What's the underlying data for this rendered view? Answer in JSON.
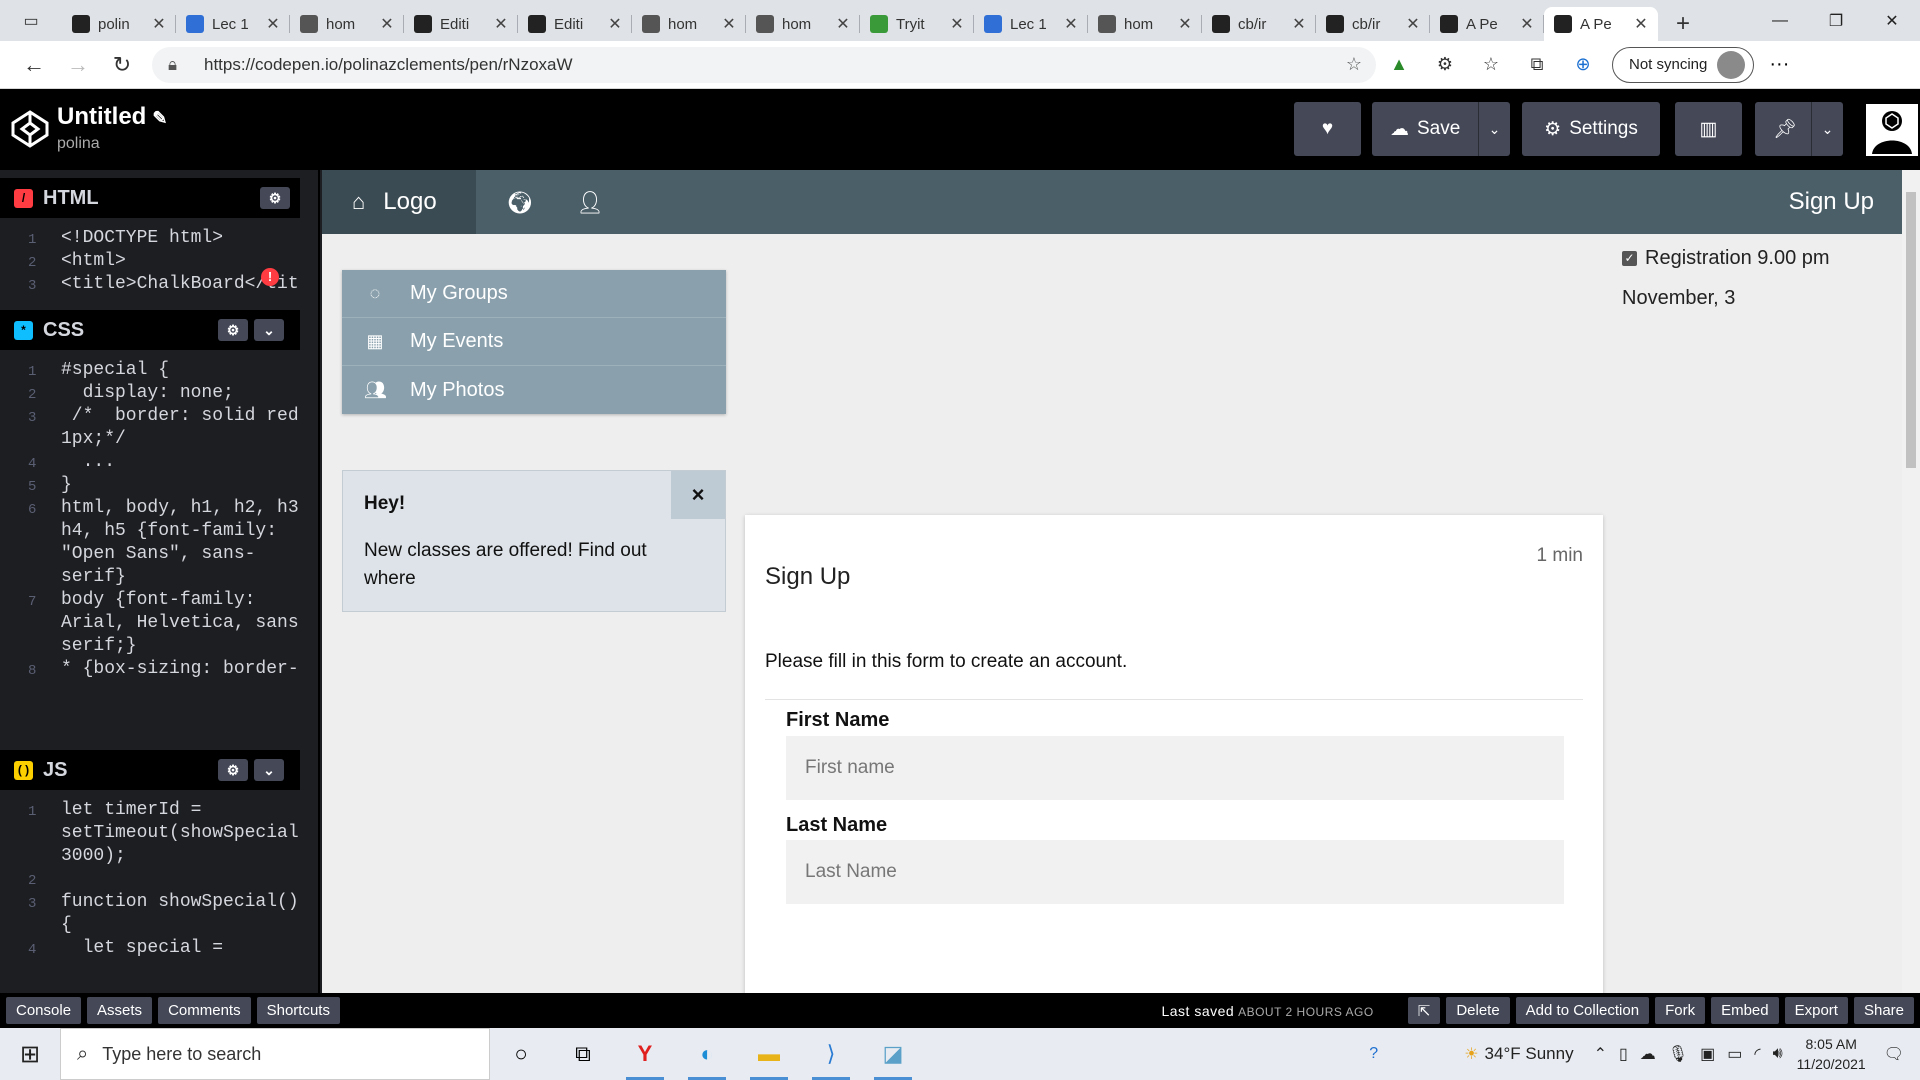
{
  "browser": {
    "tabs": [
      {
        "label": "polin",
        "color": "#222"
      },
      {
        "label": "Lec 1",
        "color": "#2f6fd6"
      },
      {
        "label": "hom",
        "color": "#555"
      },
      {
        "label": "Editi",
        "color": "#222"
      },
      {
        "label": "Editi",
        "color": "#222"
      },
      {
        "label": "hom",
        "color": "#555"
      },
      {
        "label": "hom",
        "color": "#555"
      },
      {
        "label": "Tryit",
        "color": "#3a9a3a"
      },
      {
        "label": "Lec 1",
        "color": "#2f6fd6"
      },
      {
        "label": "hom",
        "color": "#555"
      },
      {
        "label": "cb/ir",
        "color": "#222"
      },
      {
        "label": "cb/ir",
        "color": "#222"
      },
      {
        "label": "A Pe",
        "color": "#222"
      },
      {
        "label": "A Pe",
        "color": "#222"
      }
    ],
    "url": "https://codepen.io/polinazclements/pen/rNzoxaW",
    "sync_label": "Not syncing"
  },
  "codepen": {
    "title": "Untitled",
    "user": "polina",
    "buttons": {
      "save": "Save",
      "settings": "Settings"
    }
  },
  "editors": {
    "html": {
      "label": "HTML",
      "lines": [
        {
          "n": "1",
          "text": "<!DOCTYPE html>"
        },
        {
          "n": "2",
          "text": "<html>"
        },
        {
          "n": "3",
          "text": "<title>ChalkBoard</titl"
        }
      ]
    },
    "css": {
      "label": "CSS",
      "lines": [
        {
          "n": "1",
          "text": "#special {"
        },
        {
          "n": "2",
          "text": "  display: none;"
        },
        {
          "n": "3",
          "text": " /*  border: solid red"
        },
        {
          "n": "",
          "text": "1px;*/"
        },
        {
          "n": "4",
          "text": "  ..."
        },
        {
          "n": "5",
          "text": "}"
        },
        {
          "n": "6",
          "text": "html, body, h1, h2, h3,"
        },
        {
          "n": "",
          "text": "h4, h5 {font-family:"
        },
        {
          "n": "",
          "text": "\"Open Sans\", sans-"
        },
        {
          "n": "",
          "text": "serif}"
        },
        {
          "n": "7",
          "text": "body {font-family:"
        },
        {
          "n": "",
          "text": "Arial, Helvetica, sans-"
        },
        {
          "n": "",
          "text": "serif;}"
        },
        {
          "n": "8",
          "text": "* {box-sizing: border-"
        }
      ]
    },
    "js": {
      "label": "JS",
      "lines": [
        {
          "n": "1",
          "text": "let timerId ="
        },
        {
          "n": "",
          "text": "setTimeout(showSpecial,"
        },
        {
          "n": "",
          "text": "3000);"
        },
        {
          "n": "2",
          "text": ""
        },
        {
          "n": "3",
          "text": "function showSpecial()"
        },
        {
          "n": "",
          "text": "{"
        },
        {
          "n": "4",
          "text": "  let special ="
        }
      ]
    }
  },
  "preview": {
    "nav": {
      "logo": "Logo",
      "signup": "Sign Up"
    },
    "side_menu": [
      {
        "icon": "circle-notch-icon",
        "label": "My Groups"
      },
      {
        "icon": "calendar-check-icon",
        "label": "My Events"
      },
      {
        "icon": "users-icon",
        "label": "My Photos"
      }
    ],
    "alert": {
      "title": "Hey!",
      "text": "New classes are offered! Find out where",
      "close": "×"
    },
    "registration": {
      "line1": "Registration 9.00 pm",
      "line2": "November, 3"
    },
    "card": {
      "time": "1 min",
      "title": "Sign Up",
      "description": "Please fill in this form to create an account.",
      "fields": [
        {
          "label": "First Name",
          "placeholder": "First name"
        },
        {
          "label": "Last Name",
          "placeholder": "Last Name"
        }
      ]
    }
  },
  "footer": {
    "left_buttons": [
      "Console",
      "Assets",
      "Comments",
      "Shortcuts"
    ],
    "last_saved_label": "Last saved",
    "last_saved_value": "ABOUT 2 HOURS AGO",
    "right_buttons": [
      "Delete",
      "Add to Collection",
      "Fork",
      "Embed",
      "Export",
      "Share"
    ]
  },
  "taskbar": {
    "search_placeholder": "Type here to search",
    "weather": "34°F  Sunny",
    "time": "8:05 AM",
    "date": "11/20/2021"
  }
}
